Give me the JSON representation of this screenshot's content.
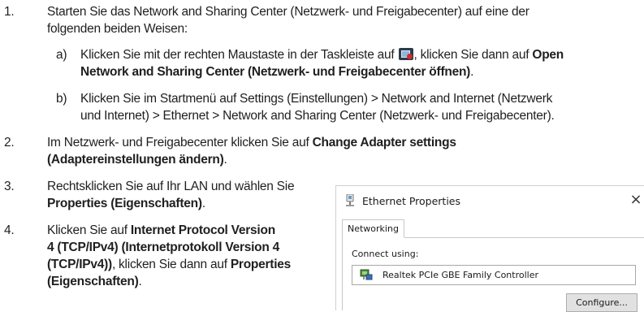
{
  "steps": {
    "s1": {
      "number": "1.",
      "line1": "Starten Sie das Network and Sharing Center (Netzwerk- und Freigabecenter) auf eine der",
      "line2": "folgenden beiden Weisen:",
      "a": {
        "letter": "a)",
        "line1_pre": "Klicken Sie mit der rechten Maustaste in der Taskleiste auf",
        "line1_mid": ", klicken Sie dann auf ",
        "line1_bold": "Open",
        "line2_bold": "Network and Sharing Center (Netzwerk- und Freigabecenter öffnen)",
        "line2_post": "."
      },
      "b": {
        "letter": "b)",
        "line1": "Klicken Sie im Startmenü auf Settings (Einstellungen) > Network and Internet (Netzwerk",
        "line2": "und Internet) > Ethernet > Network and Sharing Center (Netzwerk- und Freigabecenter)."
      }
    },
    "s2": {
      "number": "2.",
      "line1_pre": "Im Netzwerk- und Freigabecenter klicken Sie auf ",
      "line1_bold": "Change Adapter settings",
      "line2_bold": "(Adaptereinstellungen ändern)",
      "line2_post": "."
    },
    "s3": {
      "number": "3.",
      "line1": "Rechtsklicken Sie auf Ihr LAN und wählen Sie",
      "line2_bold": "Properties (Eigenschaften)",
      "line2_post": "."
    },
    "s4": {
      "number": "4.",
      "line1_pre": "Klicken Sie auf ",
      "line1_bold": "Internet Protocol Version",
      "line2_bold": "4 (TCP/IPv4) (Internetprotokoll Version 4",
      "line3_bold": "(TCP/IPv4))",
      "line3_post": ", klicken Sie dann auf ",
      "line3_bold2": "Properties",
      "line4_bold": "(Eigenschaften)",
      "line4_post": "."
    }
  },
  "dialog": {
    "title": "Ethernet Properties",
    "close_glyph": "×",
    "tab": "Networking",
    "connect_label": "Connect using:",
    "adapter_name": "Realtek PCIe GBE Family Controller",
    "configure_label": "Configure..."
  },
  "icons": {
    "tray": "network-tray-icon",
    "title": "network-adapter-icon",
    "adapter": "network-adapter-icon"
  }
}
